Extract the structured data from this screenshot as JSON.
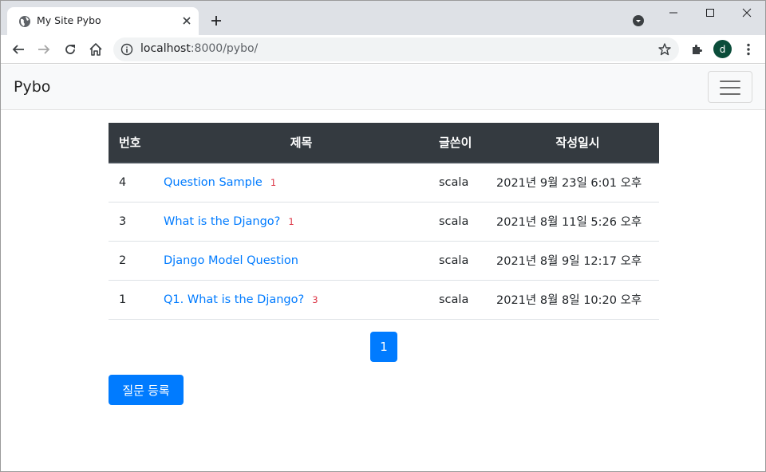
{
  "browser": {
    "tab_title": "My Site Pybo",
    "url_host": "localhost",
    "url_rest": ":8000/pybo/",
    "profile_initial": "d"
  },
  "navbar": {
    "brand": "Pybo"
  },
  "table": {
    "headers": [
      "번호",
      "제목",
      "글쓴이",
      "작성일시"
    ],
    "rows": [
      {
        "num": "4",
        "title": "Question Sample",
        "count": "1",
        "author": "scala",
        "date": "2021년 9월 23일 6:01 오후"
      },
      {
        "num": "3",
        "title": "What is the Django?",
        "count": "1",
        "author": "scala",
        "date": "2021년 8월 11일 5:26 오후"
      },
      {
        "num": "2",
        "title": "Django Model Question",
        "count": "",
        "author": "scala",
        "date": "2021년 8월 9일 12:17 오후"
      },
      {
        "num": "1",
        "title": "Q1. What is the Django?",
        "count": "3",
        "author": "scala",
        "date": "2021년 8월 8일 10:20 오후"
      }
    ]
  },
  "pagination": {
    "current_page": "1"
  },
  "actions": {
    "register_label": "질문 등록"
  },
  "colors": {
    "primary": "#007bff",
    "danger": "#dc3545",
    "table_header": "#343a40"
  }
}
